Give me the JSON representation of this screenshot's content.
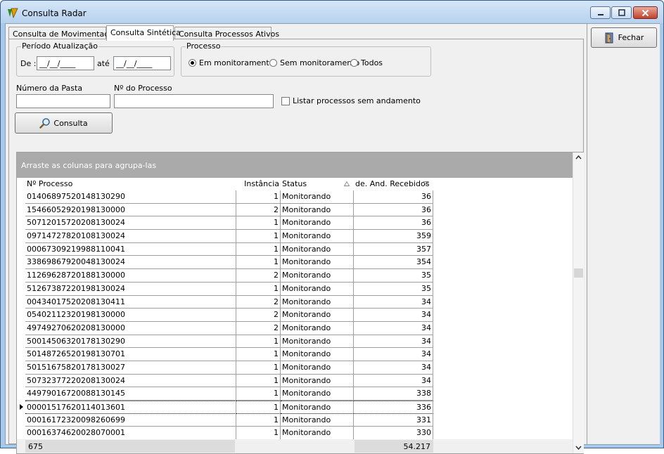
{
  "window": {
    "title": "Consulta Radar"
  },
  "tabs": [
    {
      "label": "Consulta de Movimentação"
    },
    {
      "label": "Consulta Sintética"
    },
    {
      "label": "Consulta Processos Ativos"
    }
  ],
  "periodo": {
    "title": "Período Atualização",
    "de_label": "De :",
    "de_value": "__/__/____",
    "ate_label": "até",
    "ate_value": "__/__/____"
  },
  "processo": {
    "title": "Processo",
    "options": [
      {
        "label": "Em monitoramento",
        "selected": true
      },
      {
        "label": "Sem monitoramento",
        "selected": false
      },
      {
        "label": "Todos",
        "selected": false
      }
    ]
  },
  "fields": {
    "pasta_label": "Número da Pasta",
    "pasta_value": "",
    "processo_label": "Nº do Processo",
    "processo_value": "",
    "listar_label": "Listar processos sem andamento"
  },
  "consulta_button": {
    "label": "Consulta"
  },
  "fechar_button": {
    "label": "Fechar"
  },
  "grid": {
    "group_hint": "Arraste as colunas para agrupa-las",
    "columns": [
      "Nº Processo",
      "Instância",
      "Status",
      "de. And. Recebidos"
    ],
    "rows": [
      [
        "01406897520148130290",
        "1",
        "Monitorando",
        "36"
      ],
      [
        "15466052920198130000",
        "2",
        "Monitorando",
        "36"
      ],
      [
        "50712015720208130024",
        "1",
        "Monitorando",
        "36"
      ],
      [
        "09714727820108130024",
        "1",
        "Monitorando",
        "359"
      ],
      [
        "00067309219988110041",
        "1",
        "Monitorando",
        "357"
      ],
      [
        "33869867920048130024",
        "1",
        "Monitorando",
        "354"
      ],
      [
        "11269628720188130000",
        "2",
        "Monitorando",
        "35"
      ],
      [
        "51267387220198130024",
        "1",
        "Monitorando",
        "35"
      ],
      [
        "00434017520208130411",
        "2",
        "Monitorando",
        "34"
      ],
      [
        "05402112320198130000",
        "2",
        "Monitorando",
        "34"
      ],
      [
        "49749270620208130000",
        "2",
        "Monitorando",
        "34"
      ],
      [
        "50014506320178130290",
        "1",
        "Monitorando",
        "34"
      ],
      [
        "50148726520198130701",
        "1",
        "Monitorando",
        "34"
      ],
      [
        "50151675820178130027",
        "1",
        "Monitorando",
        "34"
      ],
      [
        "50732377220208130024",
        "1",
        "Monitorando",
        "34"
      ],
      [
        "44979016720088130145",
        "1",
        "Monitorando",
        "338"
      ],
      [
        "00001517620114013601",
        "1",
        "Monitorando",
        "336"
      ],
      [
        "00016172320098260699",
        "1",
        "Monitorando",
        "331"
      ],
      [
        "00016374620028070001",
        "1",
        "Monitorando",
        "330"
      ]
    ],
    "selected_row": 16,
    "footer": {
      "count": "675",
      "total": "54.217"
    }
  }
}
